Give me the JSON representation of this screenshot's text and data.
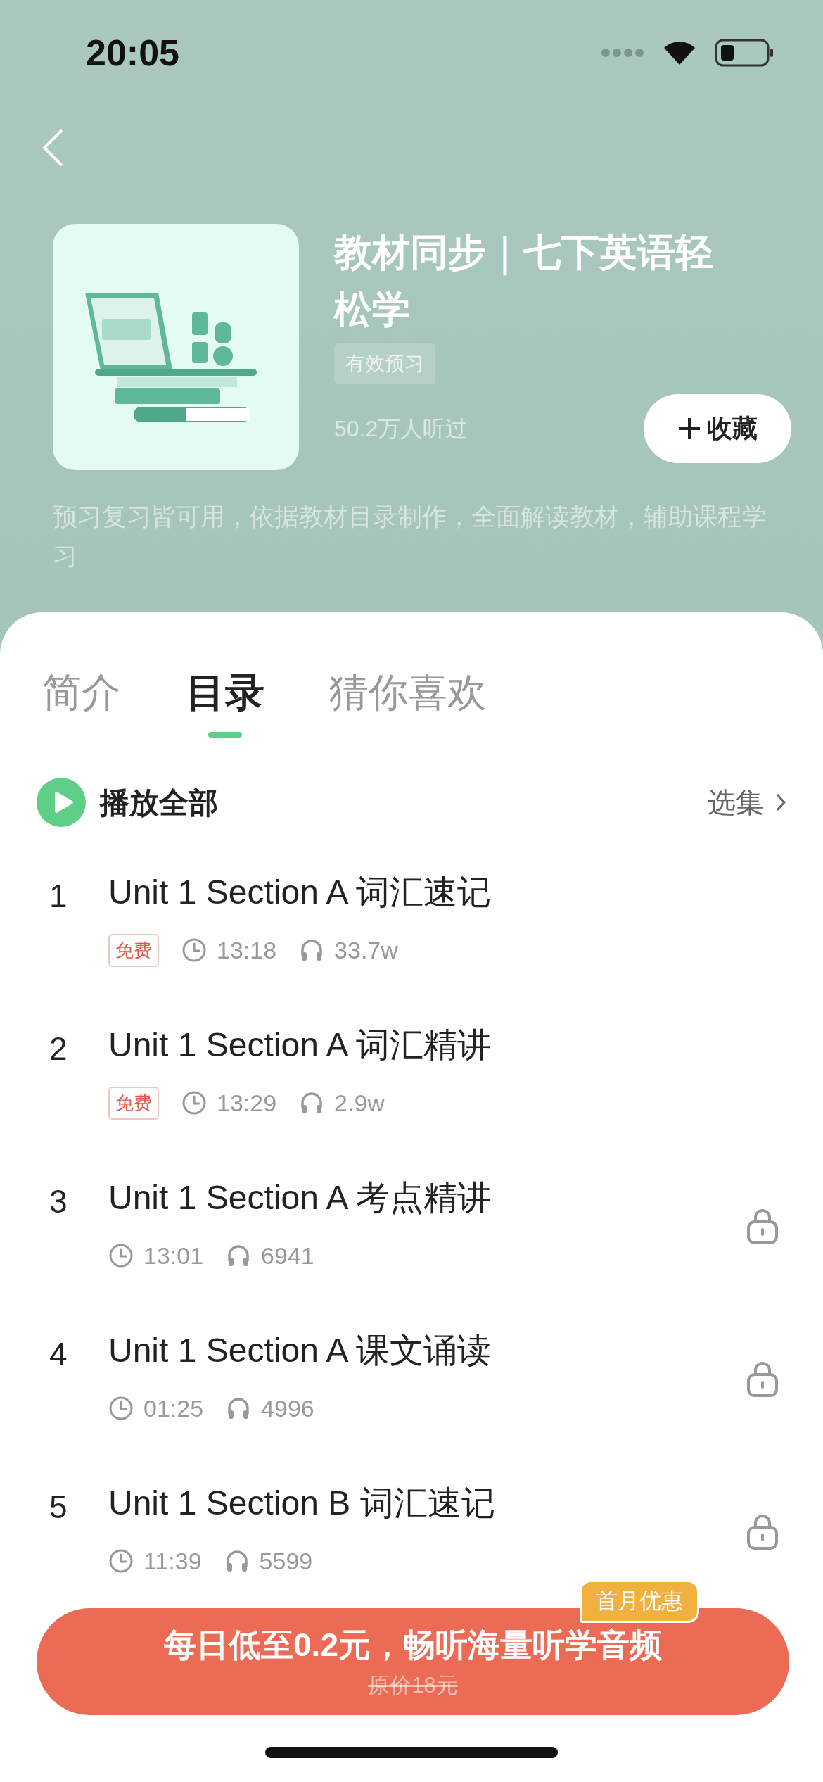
{
  "status_bar": {
    "time": "20:05"
  },
  "header": {
    "title": "教材同步｜七下英语轻松学",
    "tag": "有效预习",
    "listeners": "50.2万人听过",
    "collect_button": {
      "label": "收藏"
    },
    "description": "预习复习皆可用，依据教材目录制作，全面解读教材，辅助课程学习"
  },
  "tabs": [
    {
      "label": "简介",
      "selected": false
    },
    {
      "label": "目录",
      "selected": true
    },
    {
      "label": "猜你喜欢",
      "selected": false
    }
  ],
  "play_all": {
    "label": "播放全部",
    "select_label": "选集"
  },
  "episodes": [
    {
      "number": "1",
      "title": "Unit 1 Section A 词汇速记",
      "badge": "免费",
      "duration": "13:18",
      "plays": "33.7w",
      "locked": false
    },
    {
      "number": "2",
      "title": "Unit 1 Section A 词汇精讲",
      "badge": "免费",
      "duration": "13:29",
      "plays": "2.9w",
      "locked": false
    },
    {
      "number": "3",
      "title": "Unit 1 Section A 考点精讲",
      "duration": "13:01",
      "plays": "6941",
      "locked": true
    },
    {
      "number": "4",
      "title": "Unit 1 Section A 课文诵读",
      "duration": "01:25",
      "plays": "4996",
      "locked": true
    },
    {
      "number": "5",
      "title": "Unit 1 Section B 词汇速记",
      "duration": "11:39",
      "plays": "5599",
      "locked": true
    }
  ],
  "promo": {
    "text": "每日低至0.2元，畅听海量听学音频",
    "original_price": "原价18元",
    "badge": "首月优惠"
  }
}
